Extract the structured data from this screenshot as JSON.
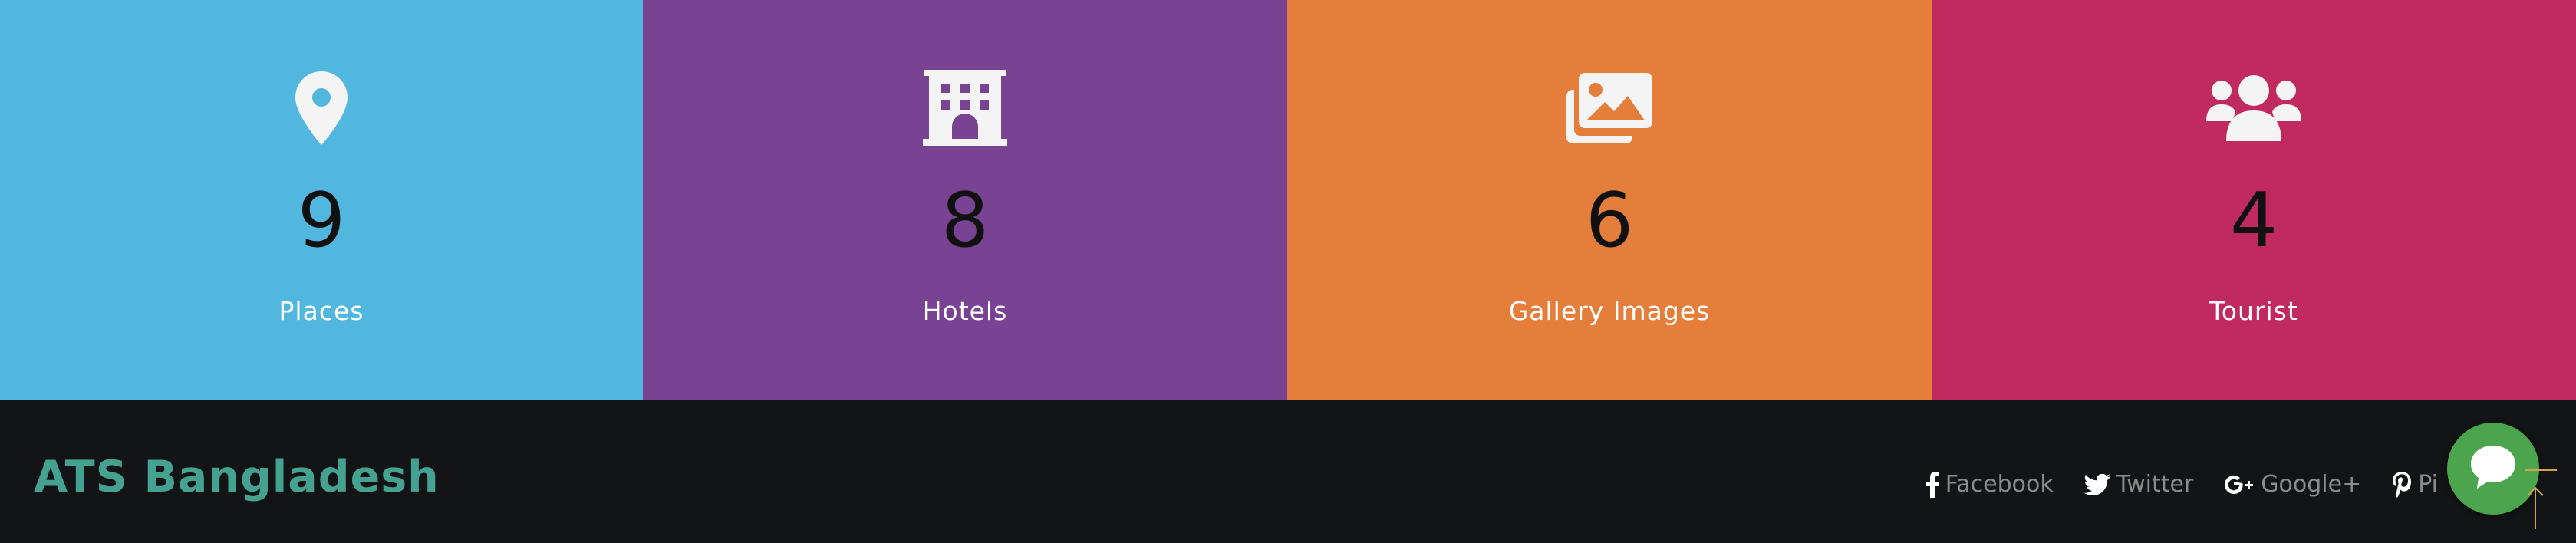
{
  "colors": {
    "places_bg": "#52b7df",
    "hotels_bg": "#784393",
    "gallery_bg": "#e57e3a",
    "tourist_bg": "#c12a5f",
    "footer_bg": "#131416",
    "brand_color": "#45a190",
    "social_text": "#8c8c8c",
    "chat_green": "#4aa54d",
    "scroll_top_gold": "#d2a24b"
  },
  "stats": [
    {
      "icon": "map-marker-icon",
      "count": "9",
      "label": "Places"
    },
    {
      "icon": "building-icon",
      "count": "8",
      "label": "Hotels"
    },
    {
      "icon": "images-icon",
      "count": "6",
      "label": "Gallery Images"
    },
    {
      "icon": "users-icon",
      "count": "4",
      "label": "Tourist"
    }
  ],
  "footer": {
    "brand": "ATS Bangladesh",
    "social": [
      {
        "icon": "facebook-icon",
        "label": "Facebook"
      },
      {
        "icon": "twitter-icon",
        "label": "Twitter"
      },
      {
        "icon": "google-plus-icon",
        "label": "Google+"
      },
      {
        "icon": "pinterest-icon",
        "label": "Pi"
      }
    ]
  },
  "widgets": {
    "chat_icon": "chat-bubble-icon",
    "scroll_top_icon": "arrow-up-icon"
  }
}
